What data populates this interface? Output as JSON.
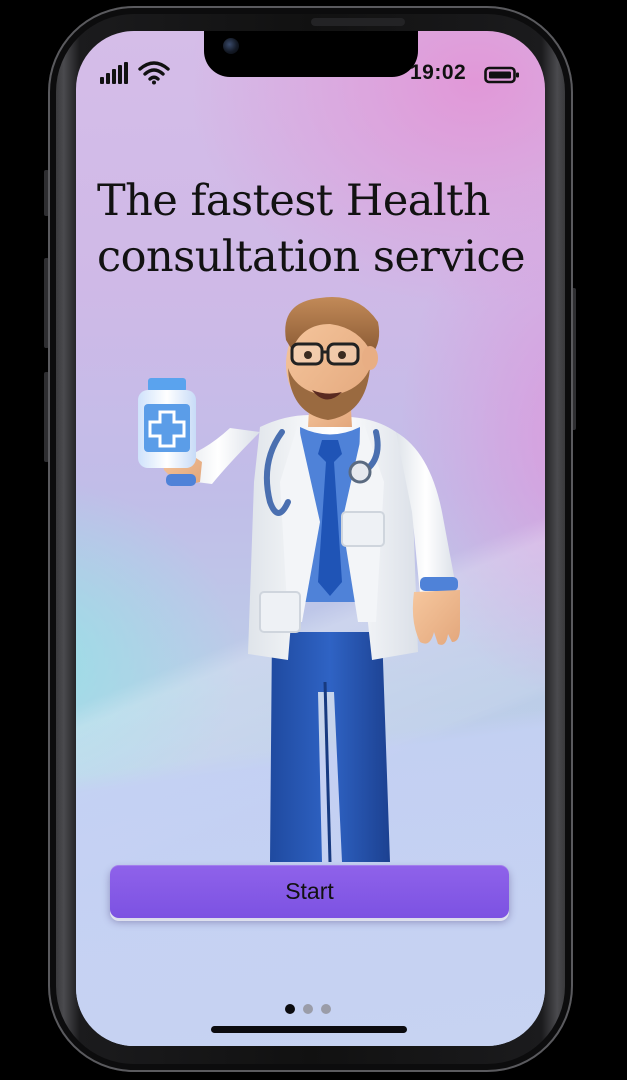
{
  "status_bar": {
    "time": "19:02",
    "signal_icon": "cellular-signal-icon",
    "wifi_icon": "wifi-icon",
    "battery_icon": "battery-icon"
  },
  "onboarding": {
    "headline_line1": "The fastest Health",
    "headline_line2": "consultation service",
    "illustration": "doctor-holding-medicine-bottle-illustration",
    "start_label": "Start",
    "pager": {
      "total": 3,
      "active": 1
    }
  },
  "colors": {
    "accent": "#7f55e4",
    "text": "#121212"
  }
}
